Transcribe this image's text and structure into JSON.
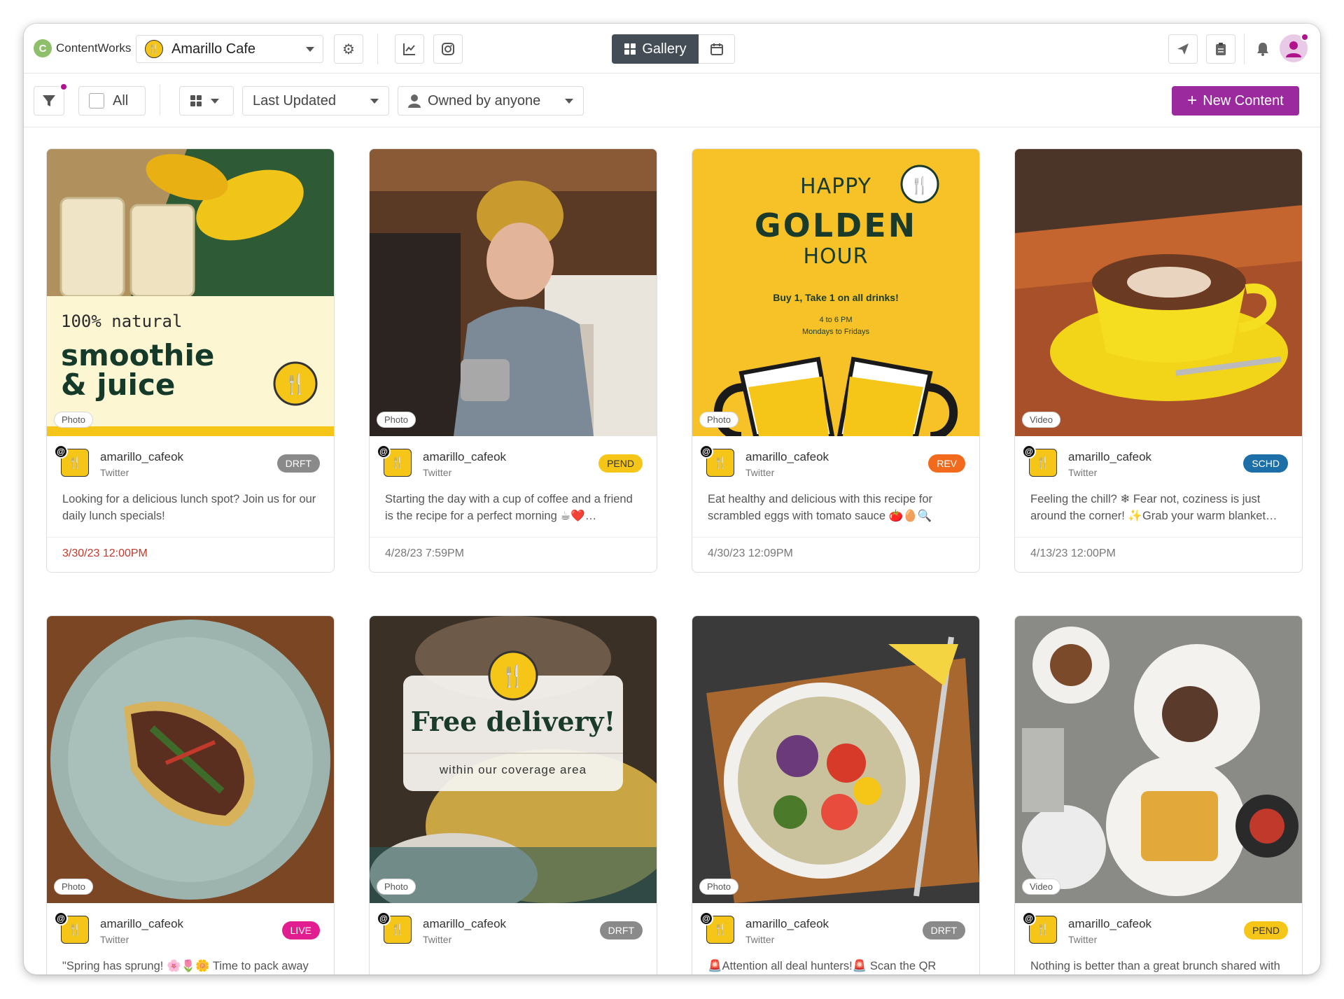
{
  "app": {
    "logo_text": "ContentWorks"
  },
  "brand": {
    "name": "Amarillo Cafe"
  },
  "view": {
    "gallery_label": "Gallery"
  },
  "filters": {
    "all_label": "All",
    "sort_label": "Last Updated",
    "owner_label": "Owned by anyone",
    "new_content_label": "New Content"
  },
  "cards": [
    {
      "type": "Photo",
      "account": "amarillo_cafeok",
      "network": "Twitter",
      "status": "DRFT",
      "text": "Looking for a delicious lunch spot? Join us for our daily lunch specials!",
      "date": "3/30/23 12:00PM",
      "art": {
        "line1": "100% natural",
        "line2": "smoothie",
        "line3": "& juice"
      }
    },
    {
      "type": "Photo",
      "account": "amarillo_cafeok",
      "network": "Twitter",
      "status": "PEND",
      "text": "Starting the day with a cup of coffee and a friend is the recipe for a perfect morning ☕❤️…",
      "date": "4/28/23 7:59PM"
    },
    {
      "type": "Photo",
      "account": "amarillo_cafeok",
      "network": "Twitter",
      "status": "REV",
      "text": "Eat healthy and delicious with this recipe for scrambled eggs with tomato sauce 🍅🥚🔍",
      "date": "4/30/23 12:09PM",
      "art": {
        "happy": "HAPPY",
        "golden": "GOLDEN",
        "hour": "HOUR",
        "promo": "Buy 1, Take 1 on all drinks!",
        "time": "4 to 6 PM",
        "days": "Mondays to Fridays"
      }
    },
    {
      "type": "Video",
      "account": "amarillo_cafeok",
      "network": "Twitter",
      "status": "SCHD",
      "text": "Feeling the chill? ❄ Fear not, coziness is just around the corner! ✨Grab your warm blanket…",
      "date": "4/13/23 12:00PM"
    },
    {
      "type": "Photo",
      "account": "amarillo_cafeok",
      "network": "Twitter",
      "status": "LIVE",
      "text": "\"Spring has sprung! 🌸🌷🌼 Time to pack away",
      "date": ""
    },
    {
      "type": "Photo",
      "account": "amarillo_cafeok",
      "network": "Twitter",
      "status": "DRFT",
      "text": "",
      "date": "",
      "art": {
        "title": "Free delivery!",
        "subtitle": "within our coverage area"
      }
    },
    {
      "type": "Photo",
      "account": "amarillo_cafeok",
      "network": "Twitter",
      "status": "DRFT",
      "text": "🚨Attention all deal hunters!🚨 Scan the QR code",
      "date": ""
    },
    {
      "type": "Video",
      "account": "amarillo_cafeok",
      "network": "Twitter",
      "status": "PEND",
      "text": "Nothing is better than a great brunch shared with",
      "date": ""
    }
  ]
}
